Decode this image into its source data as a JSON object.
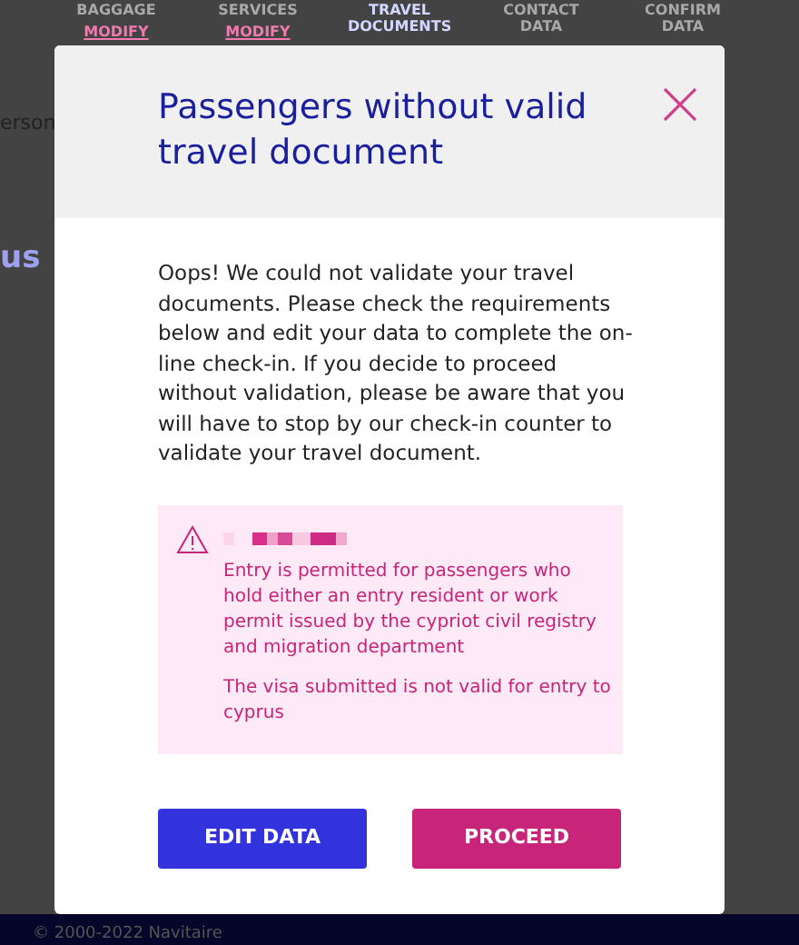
{
  "nav": [
    {
      "label": "BAGGAGE",
      "link": "MODIFY",
      "current": false
    },
    {
      "label": "SERVICES",
      "link": "MODIFY",
      "current": false
    },
    {
      "label": "TRAVEL DOCUMENTS",
      "current": true
    },
    {
      "label": "CONTACT DATA",
      "current": false
    },
    {
      "label": "CONFIRM DATA",
      "current": false
    }
  ],
  "background_fragments": [
    "erson",
    "us"
  ],
  "dialog": {
    "title": "Passengers without valid travel document",
    "message": "Oops! We could not validate your travel documents. Please check the requirements below and edit your data to complete the on-line check-in. If you decide to proceed without validation, please be aware that you will have to stop by our check-in counter to validate your travel document.",
    "alert": {
      "messages": [
        "Entry is permitted for passengers who hold either an entry resident or work permit issued by the cypriot civil registry and migration department",
        "The visa submitted is not valid for entry to cyprus"
      ]
    },
    "buttons": [
      {
        "label": "EDIT DATA",
        "kind": "secondary"
      },
      {
        "label": "PROCEED",
        "kind": "primary"
      }
    ]
  },
  "footer": {
    "text": "© 2000-2022 Navitaire"
  }
}
